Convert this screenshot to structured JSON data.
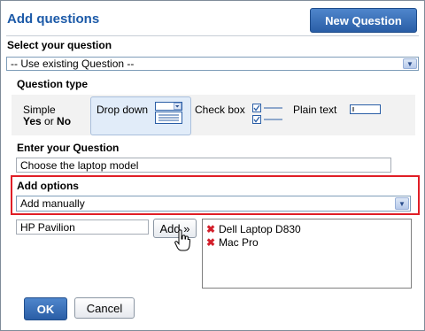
{
  "dialog": {
    "title": "Add questions",
    "new_question_label": "New Question"
  },
  "select_question": {
    "label": "Select your question",
    "value": "-- Use existing Question --"
  },
  "question_type": {
    "label": "Question type",
    "options": [
      {
        "line1": "Simple",
        "yes": "Yes",
        "or": " or ",
        "no": "No"
      },
      {
        "label": "Drop down"
      },
      {
        "label": "Check box"
      },
      {
        "label": "Plain text"
      }
    ],
    "selected": "Drop down"
  },
  "enter_question": {
    "label": "Enter your Question",
    "value": "Choose the laptop model"
  },
  "add_options": {
    "label": "Add options",
    "mode": "Add manually"
  },
  "option_input": {
    "value": "HP Pavilion"
  },
  "add_button": {
    "label": "Add »"
  },
  "options_list": {
    "items": [
      "Dell Laptop D830",
      "Mac Pro"
    ]
  },
  "footer": {
    "ok_label": "OK",
    "cancel_label": "Cancel"
  },
  "colors": {
    "accent": "#1c5aa8",
    "highlight_border": "#e01e26",
    "delete_icon": "#d3202b"
  }
}
